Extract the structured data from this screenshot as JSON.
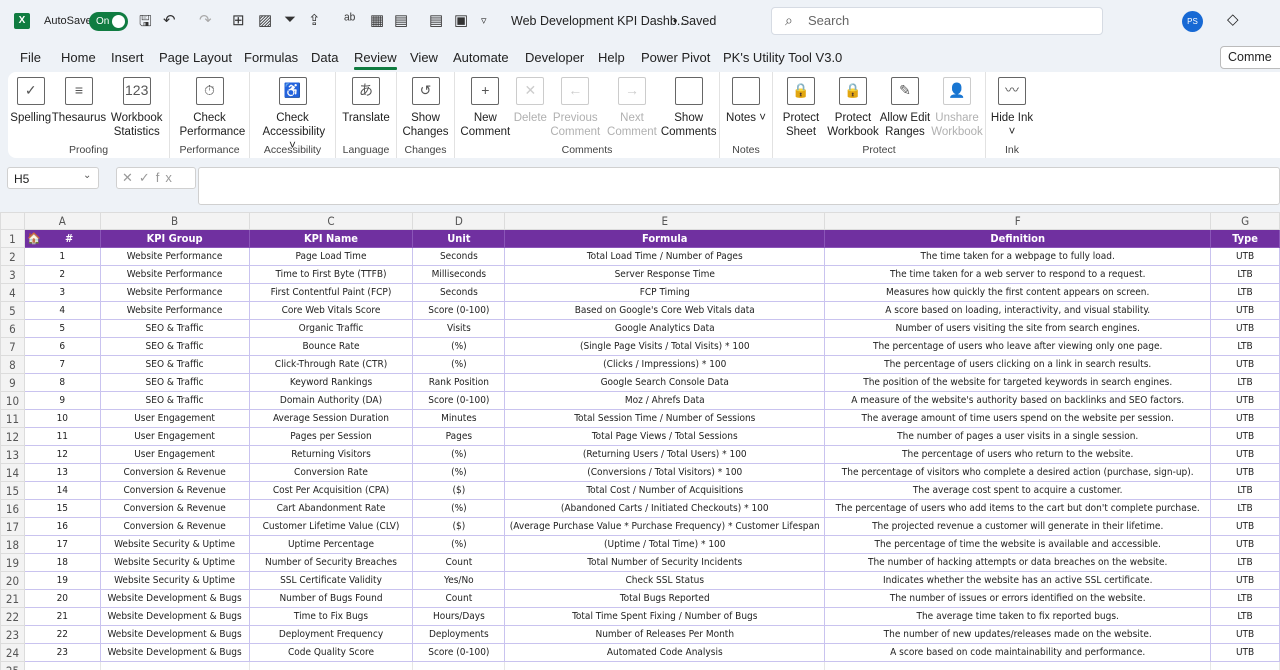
{
  "titlebar": {
    "app_icon": "X",
    "autosave_label": "AutoSave",
    "autosave_state": "On",
    "doc_title": "Web Development KPI Dashb...",
    "save_status": "• Saved",
    "search_placeholder": "Search",
    "avatar_initials": "PS"
  },
  "tabs": [
    "File",
    "Home",
    "Insert",
    "Page Layout",
    "Formulas",
    "Data",
    "Review",
    "View",
    "Automate",
    "Developer",
    "Help",
    "Power Pivot",
    "PK's Utility Tool V3.0"
  ],
  "active_tab": "Review",
  "comments_button": "Comme",
  "ribbon": [
    {
      "label": "Proofing",
      "w": 162,
      "buttons": [
        {
          "label": "Spelling",
          "icon": "abc-check-icon",
          "g": "✓"
        },
        {
          "label": "Thesaurus",
          "icon": "book-icon",
          "g": "≡"
        },
        {
          "label": "Workbook Statistics",
          "icon": "statistics-icon",
          "g": "123"
        }
      ]
    },
    {
      "label": "Performance",
      "w": 80,
      "buttons": [
        {
          "label": "Check Performance",
          "icon": "performance-icon",
          "g": "⏱"
        }
      ]
    },
    {
      "label": "Accessibility",
      "w": 86,
      "buttons": [
        {
          "label": "Check Accessibility ˅",
          "icon": "accessibility-icon",
          "g": "♿"
        }
      ]
    },
    {
      "label": "Language",
      "w": 61,
      "buttons": [
        {
          "label": "Translate",
          "icon": "translate-icon",
          "g": "あ"
        }
      ]
    },
    {
      "label": "Changes",
      "w": 58,
      "buttons": [
        {
          "label": "Show Changes",
          "icon": "show-changes-icon",
          "g": "↺"
        }
      ]
    },
    {
      "label": "Comments",
      "w": 265,
      "buttons": [
        {
          "label": "New Comment",
          "icon": "new-comment-icon",
          "g": "+"
        },
        {
          "label": "Delete",
          "icon": "delete-comment-icon",
          "g": "✕",
          "disabled": true
        },
        {
          "label": "Previous Comment",
          "icon": "previous-comment-icon",
          "g": "←",
          "disabled": true
        },
        {
          "label": "Next Comment",
          "icon": "next-comment-icon",
          "g": "→",
          "disabled": true
        },
        {
          "label": "Show Comments",
          "icon": "show-comments-icon",
          "g": ""
        }
      ]
    },
    {
      "label": "Notes",
      "w": 53,
      "buttons": [
        {
          "label": "Notes ˅",
          "icon": "notes-icon",
          "g": ""
        }
      ]
    },
    {
      "label": "Protect",
      "w": 213,
      "buttons": [
        {
          "label": "Protect Sheet",
          "icon": "protect-sheet-icon",
          "g": "🔒"
        },
        {
          "label": "Protect Workbook",
          "icon": "protect-workbook-icon",
          "g": "🔒"
        },
        {
          "label": "Allow Edit Ranges",
          "icon": "allow-edit-ranges-icon",
          "g": "✎"
        },
        {
          "label": "Unshare Workbook",
          "icon": "unshare-workbook-icon",
          "g": "👤",
          "disabled": true
        }
      ]
    },
    {
      "label": "Ink",
      "w": 52,
      "buttons": [
        {
          "label": "Hide Ink ˅",
          "icon": "hide-ink-icon",
          "g": "〰"
        }
      ]
    }
  ],
  "formula_bar": {
    "name_box": "H5",
    "fx": "✕✓fx",
    "formula": ""
  },
  "grid": {
    "column_letters": [
      "A",
      "B",
      "C",
      "D",
      "E",
      "F",
      "G"
    ],
    "headers": [
      "#",
      "KPI Group",
      "KPI Name",
      "Unit",
      "Formula",
      "Definition",
      "Type"
    ],
    "header_color": "#7030a0",
    "rows": [
      [
        "1",
        "Website Performance",
        "Page Load Time",
        "Seconds",
        "Total Load Time / Number of Pages",
        "The time taken for a webpage to fully load.",
        "UTB"
      ],
      [
        "2",
        "Website Performance",
        "Time to First Byte (TTFB)",
        "Milliseconds",
        "Server Response Time",
        "The time taken for a web server to respond to a request.",
        "LTB"
      ],
      [
        "3",
        "Website Performance",
        "First Contentful Paint (FCP)",
        "Seconds",
        "FCP Timing",
        "Measures how quickly the first content appears on screen.",
        "LTB"
      ],
      [
        "4",
        "Website Performance",
        "Core Web Vitals Score",
        "Score (0-100)",
        "Based on Google's Core Web Vitals data",
        "A score based on loading, interactivity, and visual stability.",
        "UTB"
      ],
      [
        "5",
        "SEO & Traffic",
        "Organic Traffic",
        "Visits",
        "Google Analytics Data",
        "Number of users visiting the site from search engines.",
        "UTB"
      ],
      [
        "6",
        "SEO & Traffic",
        "Bounce Rate",
        "(%)",
        "(Single Page Visits / Total Visits) * 100",
        "The percentage of users who leave after viewing only one page.",
        "LTB"
      ],
      [
        "7",
        "SEO & Traffic",
        "Click-Through Rate (CTR)",
        "(%)",
        "(Clicks / Impressions) * 100",
        "The percentage of users clicking on a link in search results.",
        "UTB"
      ],
      [
        "8",
        "SEO & Traffic",
        "Keyword Rankings",
        "Rank Position",
        "Google Search Console Data",
        "The position of the website for targeted keywords in search engines.",
        "LTB"
      ],
      [
        "9",
        "SEO & Traffic",
        "Domain Authority (DA)",
        "Score (0-100)",
        "Moz / Ahrefs Data",
        "A measure of the website's authority based on backlinks and SEO factors.",
        "UTB"
      ],
      [
        "10",
        "User Engagement",
        "Average Session Duration",
        "Minutes",
        "Total Session Time / Number of Sessions",
        "The average amount of time users spend on the website per session.",
        "UTB"
      ],
      [
        "11",
        "User Engagement",
        "Pages per Session",
        "Pages",
        "Total Page Views / Total Sessions",
        "The number of pages a user visits in a single session.",
        "UTB"
      ],
      [
        "12",
        "User Engagement",
        "Returning Visitors",
        "(%)",
        "(Returning Users / Total Users) * 100",
        "The percentage of users who return to the website.",
        "UTB"
      ],
      [
        "13",
        "Conversion & Revenue",
        "Conversion Rate",
        "(%)",
        "(Conversions / Total Visitors) * 100",
        "The percentage of visitors who complete a desired action (purchase, sign-up).",
        "UTB"
      ],
      [
        "14",
        "Conversion & Revenue",
        "Cost Per Acquisition (CPA)",
        "($)",
        "Total Cost / Number of Acquisitions",
        "The average cost spent to acquire a customer.",
        "LTB"
      ],
      [
        "15",
        "Conversion & Revenue",
        "Cart Abandonment Rate",
        "(%)",
        "(Abandoned Carts / Initiated Checkouts) * 100",
        "The percentage of users who add items to the cart but don't complete purchase.",
        "LTB"
      ],
      [
        "16",
        "Conversion & Revenue",
        "Customer Lifetime Value (CLV)",
        "($)",
        "(Average Purchase Value * Purchase Frequency) * Customer Lifespan",
        "The projected revenue a customer will generate in their lifetime.",
        "UTB"
      ],
      [
        "17",
        "Website Security & Uptime",
        "Uptime Percentage",
        "(%)",
        "(Uptime / Total Time) * 100",
        "The percentage of time the website is available and accessible.",
        "UTB"
      ],
      [
        "18",
        "Website Security & Uptime",
        "Number of Security Breaches",
        "Count",
        "Total Number of Security Incidents",
        "The number of hacking attempts or data breaches on the website.",
        "LTB"
      ],
      [
        "19",
        "Website Security & Uptime",
        "SSL Certificate Validity",
        "Yes/No",
        "Check SSL Status",
        "Indicates whether the website has an active SSL certificate.",
        "UTB"
      ],
      [
        "20",
        "Website Development & Bugs",
        "Number of Bugs Found",
        "Count",
        "Total Bugs Reported",
        "The number of issues or errors identified on the website.",
        "LTB"
      ],
      [
        "21",
        "Website Development & Bugs",
        "Time to Fix Bugs",
        "Hours/Days",
        "Total Time Spent Fixing / Number of Bugs",
        "The average time taken to fix reported bugs.",
        "LTB"
      ],
      [
        "22",
        "Website Development & Bugs",
        "Deployment Frequency",
        "Deployments",
        "Number of Releases Per Month",
        "The number of new updates/releases made on the website.",
        "UTB"
      ],
      [
        "23",
        "Website Development & Bugs",
        "Code Quality Score",
        "Score (0-100)",
        "Automated Code Analysis",
        "A score based on code maintainability and performance.",
        "UTB"
      ]
    ]
  }
}
